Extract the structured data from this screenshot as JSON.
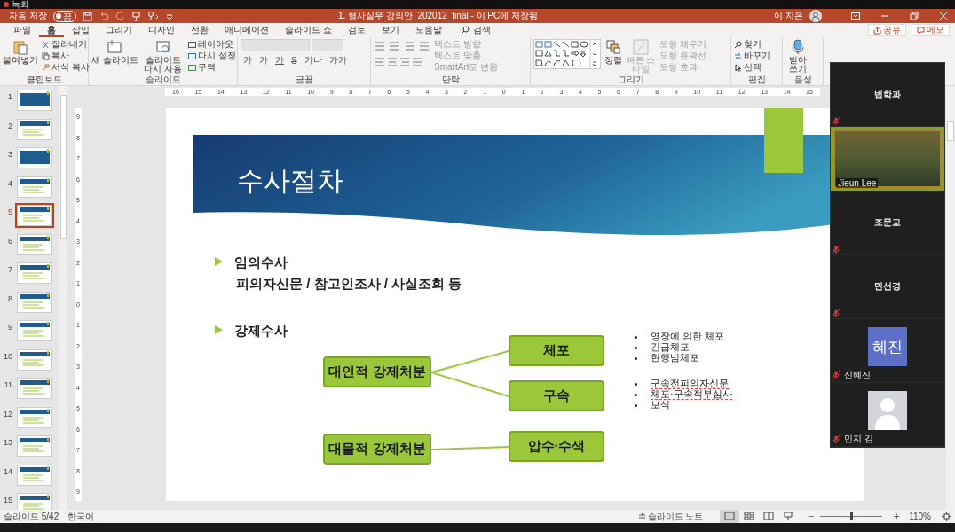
{
  "recording": {
    "label": "녹화"
  },
  "title_bar": {
    "autosave_label": "자동 저장",
    "autosave": {
      "on": false,
      "state_label": "끔"
    },
    "title": "1. 형사실무 강의안_202012_final - 이 PC에 저장됨",
    "user": "이 지은"
  },
  "tabs": [
    {
      "label": "파일",
      "selected": false
    },
    {
      "label": "홈",
      "selected": true
    },
    {
      "label": "삽입",
      "selected": false
    },
    {
      "label": "그리기",
      "selected": false
    },
    {
      "label": "디자인",
      "selected": false
    },
    {
      "label": "전환",
      "selected": false
    },
    {
      "label": "애니메이션",
      "selected": false
    },
    {
      "label": "슬라이드 쇼",
      "selected": false
    },
    {
      "label": "검토",
      "selected": false
    },
    {
      "label": "보기",
      "selected": false
    },
    {
      "label": "도움말",
      "selected": false
    }
  ],
  "search": {
    "label": "검색"
  },
  "share_button": "공유",
  "comment_button": "메모",
  "clipboard": {
    "title": "클립보드",
    "paste": "붙여넣기",
    "cut": "잘라내기",
    "copy": "복사",
    "format_painter": "서식 복사"
  },
  "slides_group": {
    "title": "슬라이드",
    "new_slide": "새 슬라이드",
    "reuse": "슬라이드 다시 사용",
    "layout": "레이아웃",
    "reset": "다시 설정",
    "section": "구역"
  },
  "font": {
    "title": "글꼴",
    "format_buttons": [
      "가",
      "가",
      "가",
      "S",
      "가나",
      "가가"
    ]
  },
  "paragraph": {
    "title": "단락",
    "items": [
      {
        "label": "텍스트 방향",
        "disabled": true
      },
      {
        "label": "텍스트 맞춤",
        "disabled": true
      },
      {
        "label": "SmartArt로 변환",
        "disabled": true
      }
    ]
  },
  "drawing": {
    "title": "그리기",
    "arrange": "정렬",
    "quick_styles": {
      "label": "빠른 스타일",
      "disabled": true
    },
    "items": [
      {
        "label": "도형 채우기",
        "disabled": true
      },
      {
        "label": "도형 윤곽선",
        "disabled": true
      },
      {
        "label": "도형 효과",
        "disabled": true
      }
    ]
  },
  "editing": {
    "title": "편집",
    "find": "찾기",
    "replace": "바꾸기",
    "select": "선택"
  },
  "voice": {
    "title": "음성",
    "dictate": "받아 쓰기"
  },
  "h_ruler": [
    "16",
    "15",
    "14",
    "13",
    "12",
    "11",
    "10",
    "9",
    "8",
    "7",
    "6",
    "5",
    "4",
    "3",
    "2",
    "1",
    "0",
    "1",
    "2",
    "3",
    "4",
    "5",
    "6",
    "7",
    "8",
    "9",
    "10",
    "11",
    "12",
    "13",
    "14",
    "15"
  ],
  "v_ruler": [
    "9",
    "8",
    "7",
    "6",
    "5",
    "4",
    "3",
    "2",
    "1",
    "0",
    "1",
    "2",
    "3",
    "4",
    "5",
    "6",
    "7",
    "8",
    "9"
  ],
  "thumbnails": [
    {
      "number": "1",
      "kind": "title",
      "selected": false
    },
    {
      "number": "2",
      "kind": "content",
      "selected": false
    },
    {
      "number": "3",
      "kind": "title",
      "selected": false
    },
    {
      "number": "4",
      "kind": "content",
      "selected": false
    },
    {
      "number": "5",
      "kind": "content",
      "selected": true
    },
    {
      "number": "6",
      "kind": "content",
      "selected": false
    },
    {
      "number": "7",
      "kind": "content",
      "selected": false
    },
    {
      "number": "8",
      "kind": "content",
      "selected": false
    },
    {
      "number": "9",
      "kind": "content",
      "selected": false
    },
    {
      "number": "10",
      "kind": "content",
      "selected": false
    },
    {
      "number": "11",
      "kind": "content",
      "selected": false
    },
    {
      "number": "12",
      "kind": "content",
      "selected": false
    },
    {
      "number": "13",
      "kind": "content",
      "selected": false
    },
    {
      "number": "14",
      "kind": "content",
      "selected": false
    },
    {
      "number": "15",
      "kind": "content",
      "selected": false
    }
  ],
  "slide": {
    "title": "수사절차",
    "sections": [
      {
        "heading": "임의수사",
        "detail": "피의자신문 / 참고인조사 / 사실조회 등"
      },
      {
        "heading": "강제수사"
      }
    ],
    "nodes": [
      {
        "label": "체포"
      },
      {
        "label": "대인적 강제처분"
      },
      {
        "label": "구속"
      },
      {
        "label": "대물적 강제처분"
      },
      {
        "label": "압수·수색"
      }
    ],
    "bullet_groups": [
      [
        {
          "text": "영장에 의한 체포",
          "misspelled": false
        },
        {
          "text": "긴급체포",
          "misspelled": false
        },
        {
          "text": "현행범체포",
          "misspelled": false
        }
      ],
      [
        {
          "text": "구속전피의자신문",
          "misspelled": true
        },
        {
          "text": "체포·구속적부심사",
          "misspelled": true
        },
        {
          "text": "보석",
          "misspelled": false
        }
      ]
    ]
  },
  "participants": [
    {
      "kind": "name",
      "name": "법학과",
      "muted": true
    },
    {
      "kind": "video",
      "name": "Jieun Lee",
      "muted": false,
      "speaking": true
    },
    {
      "kind": "name",
      "name": "조문교",
      "muted": true
    },
    {
      "kind": "name",
      "name": "민선경",
      "muted": true
    },
    {
      "kind": "initials",
      "initials": "혜진",
      "name": "신혜진",
      "muted": true
    },
    {
      "kind": "silhouette",
      "name": "민지 김",
      "muted": true
    }
  ],
  "status_bar": {
    "slide": "슬라이드 5/42",
    "language": "한국어",
    "notes": "슬라이드 노트",
    "views": [
      {
        "kind": "normal",
        "selected": true
      },
      {
        "kind": "sorter",
        "selected": false
      },
      {
        "kind": "reading",
        "selected": false
      },
      {
        "kind": "slideshow",
        "selected": false
      }
    ],
    "zoom_out": "−",
    "zoom_in": "+",
    "zoom": {
      "level": 0.5,
      "label": "110%"
    }
  }
}
